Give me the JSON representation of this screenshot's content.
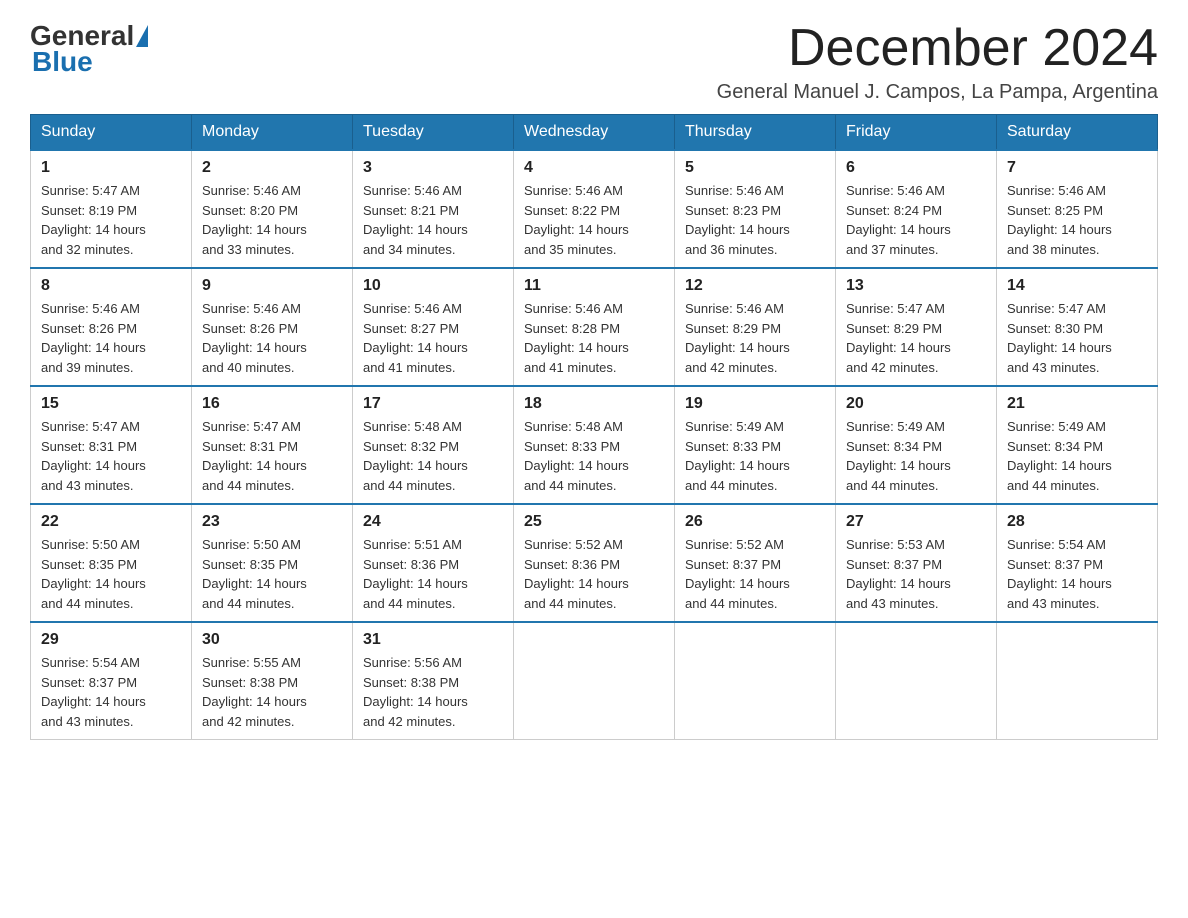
{
  "logo": {
    "general": "General",
    "blue": "Blue",
    "subtitle": "Blue"
  },
  "title": "December 2024",
  "subtitle": "General Manuel J. Campos, La Pampa, Argentina",
  "days_of_week": [
    "Sunday",
    "Monday",
    "Tuesday",
    "Wednesday",
    "Thursday",
    "Friday",
    "Saturday"
  ],
  "weeks": [
    [
      {
        "day": "1",
        "sunrise": "Sunrise: 5:47 AM",
        "sunset": "Sunset: 8:19 PM",
        "daylight": "Daylight: 14 hours",
        "minutes": "and 32 minutes."
      },
      {
        "day": "2",
        "sunrise": "Sunrise: 5:46 AM",
        "sunset": "Sunset: 8:20 PM",
        "daylight": "Daylight: 14 hours",
        "minutes": "and 33 minutes."
      },
      {
        "day": "3",
        "sunrise": "Sunrise: 5:46 AM",
        "sunset": "Sunset: 8:21 PM",
        "daylight": "Daylight: 14 hours",
        "minutes": "and 34 minutes."
      },
      {
        "day": "4",
        "sunrise": "Sunrise: 5:46 AM",
        "sunset": "Sunset: 8:22 PM",
        "daylight": "Daylight: 14 hours",
        "minutes": "and 35 minutes."
      },
      {
        "day": "5",
        "sunrise": "Sunrise: 5:46 AM",
        "sunset": "Sunset: 8:23 PM",
        "daylight": "Daylight: 14 hours",
        "minutes": "and 36 minutes."
      },
      {
        "day": "6",
        "sunrise": "Sunrise: 5:46 AM",
        "sunset": "Sunset: 8:24 PM",
        "daylight": "Daylight: 14 hours",
        "minutes": "and 37 minutes."
      },
      {
        "day": "7",
        "sunrise": "Sunrise: 5:46 AM",
        "sunset": "Sunset: 8:25 PM",
        "daylight": "Daylight: 14 hours",
        "minutes": "and 38 minutes."
      }
    ],
    [
      {
        "day": "8",
        "sunrise": "Sunrise: 5:46 AM",
        "sunset": "Sunset: 8:26 PM",
        "daylight": "Daylight: 14 hours",
        "minutes": "and 39 minutes."
      },
      {
        "day": "9",
        "sunrise": "Sunrise: 5:46 AM",
        "sunset": "Sunset: 8:26 PM",
        "daylight": "Daylight: 14 hours",
        "minutes": "and 40 minutes."
      },
      {
        "day": "10",
        "sunrise": "Sunrise: 5:46 AM",
        "sunset": "Sunset: 8:27 PM",
        "daylight": "Daylight: 14 hours",
        "minutes": "and 41 minutes."
      },
      {
        "day": "11",
        "sunrise": "Sunrise: 5:46 AM",
        "sunset": "Sunset: 8:28 PM",
        "daylight": "Daylight: 14 hours",
        "minutes": "and 41 minutes."
      },
      {
        "day": "12",
        "sunrise": "Sunrise: 5:46 AM",
        "sunset": "Sunset: 8:29 PM",
        "daylight": "Daylight: 14 hours",
        "minutes": "and 42 minutes."
      },
      {
        "day": "13",
        "sunrise": "Sunrise: 5:47 AM",
        "sunset": "Sunset: 8:29 PM",
        "daylight": "Daylight: 14 hours",
        "minutes": "and 42 minutes."
      },
      {
        "day": "14",
        "sunrise": "Sunrise: 5:47 AM",
        "sunset": "Sunset: 8:30 PM",
        "daylight": "Daylight: 14 hours",
        "minutes": "and 43 minutes."
      }
    ],
    [
      {
        "day": "15",
        "sunrise": "Sunrise: 5:47 AM",
        "sunset": "Sunset: 8:31 PM",
        "daylight": "Daylight: 14 hours",
        "minutes": "and 43 minutes."
      },
      {
        "day": "16",
        "sunrise": "Sunrise: 5:47 AM",
        "sunset": "Sunset: 8:31 PM",
        "daylight": "Daylight: 14 hours",
        "minutes": "and 44 minutes."
      },
      {
        "day": "17",
        "sunrise": "Sunrise: 5:48 AM",
        "sunset": "Sunset: 8:32 PM",
        "daylight": "Daylight: 14 hours",
        "minutes": "and 44 minutes."
      },
      {
        "day": "18",
        "sunrise": "Sunrise: 5:48 AM",
        "sunset": "Sunset: 8:33 PM",
        "daylight": "Daylight: 14 hours",
        "minutes": "and 44 minutes."
      },
      {
        "day": "19",
        "sunrise": "Sunrise: 5:49 AM",
        "sunset": "Sunset: 8:33 PM",
        "daylight": "Daylight: 14 hours",
        "minutes": "and 44 minutes."
      },
      {
        "day": "20",
        "sunrise": "Sunrise: 5:49 AM",
        "sunset": "Sunset: 8:34 PM",
        "daylight": "Daylight: 14 hours",
        "minutes": "and 44 minutes."
      },
      {
        "day": "21",
        "sunrise": "Sunrise: 5:49 AM",
        "sunset": "Sunset: 8:34 PM",
        "daylight": "Daylight: 14 hours",
        "minutes": "and 44 minutes."
      }
    ],
    [
      {
        "day": "22",
        "sunrise": "Sunrise: 5:50 AM",
        "sunset": "Sunset: 8:35 PM",
        "daylight": "Daylight: 14 hours",
        "minutes": "and 44 minutes."
      },
      {
        "day": "23",
        "sunrise": "Sunrise: 5:50 AM",
        "sunset": "Sunset: 8:35 PM",
        "daylight": "Daylight: 14 hours",
        "minutes": "and 44 minutes."
      },
      {
        "day": "24",
        "sunrise": "Sunrise: 5:51 AM",
        "sunset": "Sunset: 8:36 PM",
        "daylight": "Daylight: 14 hours",
        "minutes": "and 44 minutes."
      },
      {
        "day": "25",
        "sunrise": "Sunrise: 5:52 AM",
        "sunset": "Sunset: 8:36 PM",
        "daylight": "Daylight: 14 hours",
        "minutes": "and 44 minutes."
      },
      {
        "day": "26",
        "sunrise": "Sunrise: 5:52 AM",
        "sunset": "Sunset: 8:37 PM",
        "daylight": "Daylight: 14 hours",
        "minutes": "and 44 minutes."
      },
      {
        "day": "27",
        "sunrise": "Sunrise: 5:53 AM",
        "sunset": "Sunset: 8:37 PM",
        "daylight": "Daylight: 14 hours",
        "minutes": "and 43 minutes."
      },
      {
        "day": "28",
        "sunrise": "Sunrise: 5:54 AM",
        "sunset": "Sunset: 8:37 PM",
        "daylight": "Daylight: 14 hours",
        "minutes": "and 43 minutes."
      }
    ],
    [
      {
        "day": "29",
        "sunrise": "Sunrise: 5:54 AM",
        "sunset": "Sunset: 8:37 PM",
        "daylight": "Daylight: 14 hours",
        "minutes": "and 43 minutes."
      },
      {
        "day": "30",
        "sunrise": "Sunrise: 5:55 AM",
        "sunset": "Sunset: 8:38 PM",
        "daylight": "Daylight: 14 hours",
        "minutes": "and 42 minutes."
      },
      {
        "day": "31",
        "sunrise": "Sunrise: 5:56 AM",
        "sunset": "Sunset: 8:38 PM",
        "daylight": "Daylight: 14 hours",
        "minutes": "and 42 minutes."
      },
      null,
      null,
      null,
      null
    ]
  ]
}
